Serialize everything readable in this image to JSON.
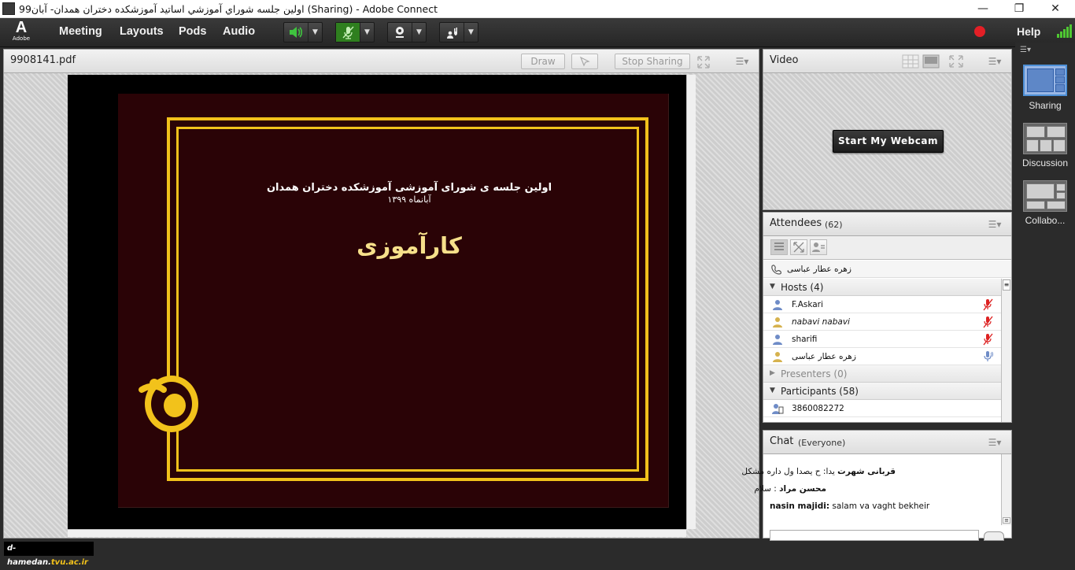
{
  "window": {
    "title": "اولین جلسه شوراي آموزشي اساتید آموزشکده دختران همدان- آبان99 (Sharing) - Adobe Connect",
    "icon": "adobe-connect-icon",
    "controls": {
      "minimize": "—",
      "restore": "❐",
      "close": "✕"
    }
  },
  "menubar": {
    "logo_text": "Adobe",
    "items": [
      "Meeting",
      "Layouts",
      "Pods",
      "Audio"
    ],
    "help_label": "Help",
    "tools": [
      "speaker-icon",
      "microphone-icon",
      "webcam-icon",
      "raise-hand-icon"
    ],
    "colors": {
      "speaker": "#3fc43f",
      "mic_bg": "#2f7f1f"
    }
  },
  "share_pod": {
    "title": "9908141.pdf",
    "draw_label": "Draw",
    "stop_label": "Stop Sharing",
    "slide": {
      "title": "اولین جلسه ی شورای آموزشی آموزشکده دختران همدان",
      "date": "آبانماه ۱۳۹۹",
      "heading": "کارآموزی"
    },
    "watermark": {
      "prefix": "d-hamedan.",
      "highlight": "tvu.ac.ir"
    }
  },
  "video_pod": {
    "title": "Video",
    "start_webcam_label": "Start My Webcam"
  },
  "attendees_pod": {
    "title": "Attendees",
    "count": "(62)",
    "speaking_name": "زهره   عطار عباسی",
    "hosts_label": "Hosts (4)",
    "hosts": [
      {
        "name": "F.Askari",
        "italic": false,
        "mic": "mic-muted"
      },
      {
        "name": "nabavi nabavi",
        "italic": true,
        "mic": "mic-muted"
      },
      {
        "name": "sharifi",
        "italic": false,
        "mic": "mic-muted"
      },
      {
        "name": "زهره   عطار عباسی",
        "italic": false,
        "mic": "mic-active"
      }
    ],
    "presenters_label": "Presenters (0)",
    "participants_label": "Participants (58)",
    "participants": [
      {
        "name": "3860082272"
      }
    ]
  },
  "chat_pod": {
    "title": "Chat",
    "scope": "(Everyone)",
    "messages": [
      {
        "who": "قربانی شهرت",
        "text": "یدا:  ح یصدا ول داره مشکل"
      },
      {
        "who": "محسن مراد",
        "text": "سلام"
      },
      {
        "who": "nasin majidi:",
        "text": " salam va vaght bekheir"
      }
    ]
  },
  "layouts_strip": {
    "items": [
      {
        "label": "Sharing",
        "selected": true
      },
      {
        "label": "Discussion",
        "selected": false
      },
      {
        "label": "Collabo...",
        "selected": false
      }
    ]
  }
}
